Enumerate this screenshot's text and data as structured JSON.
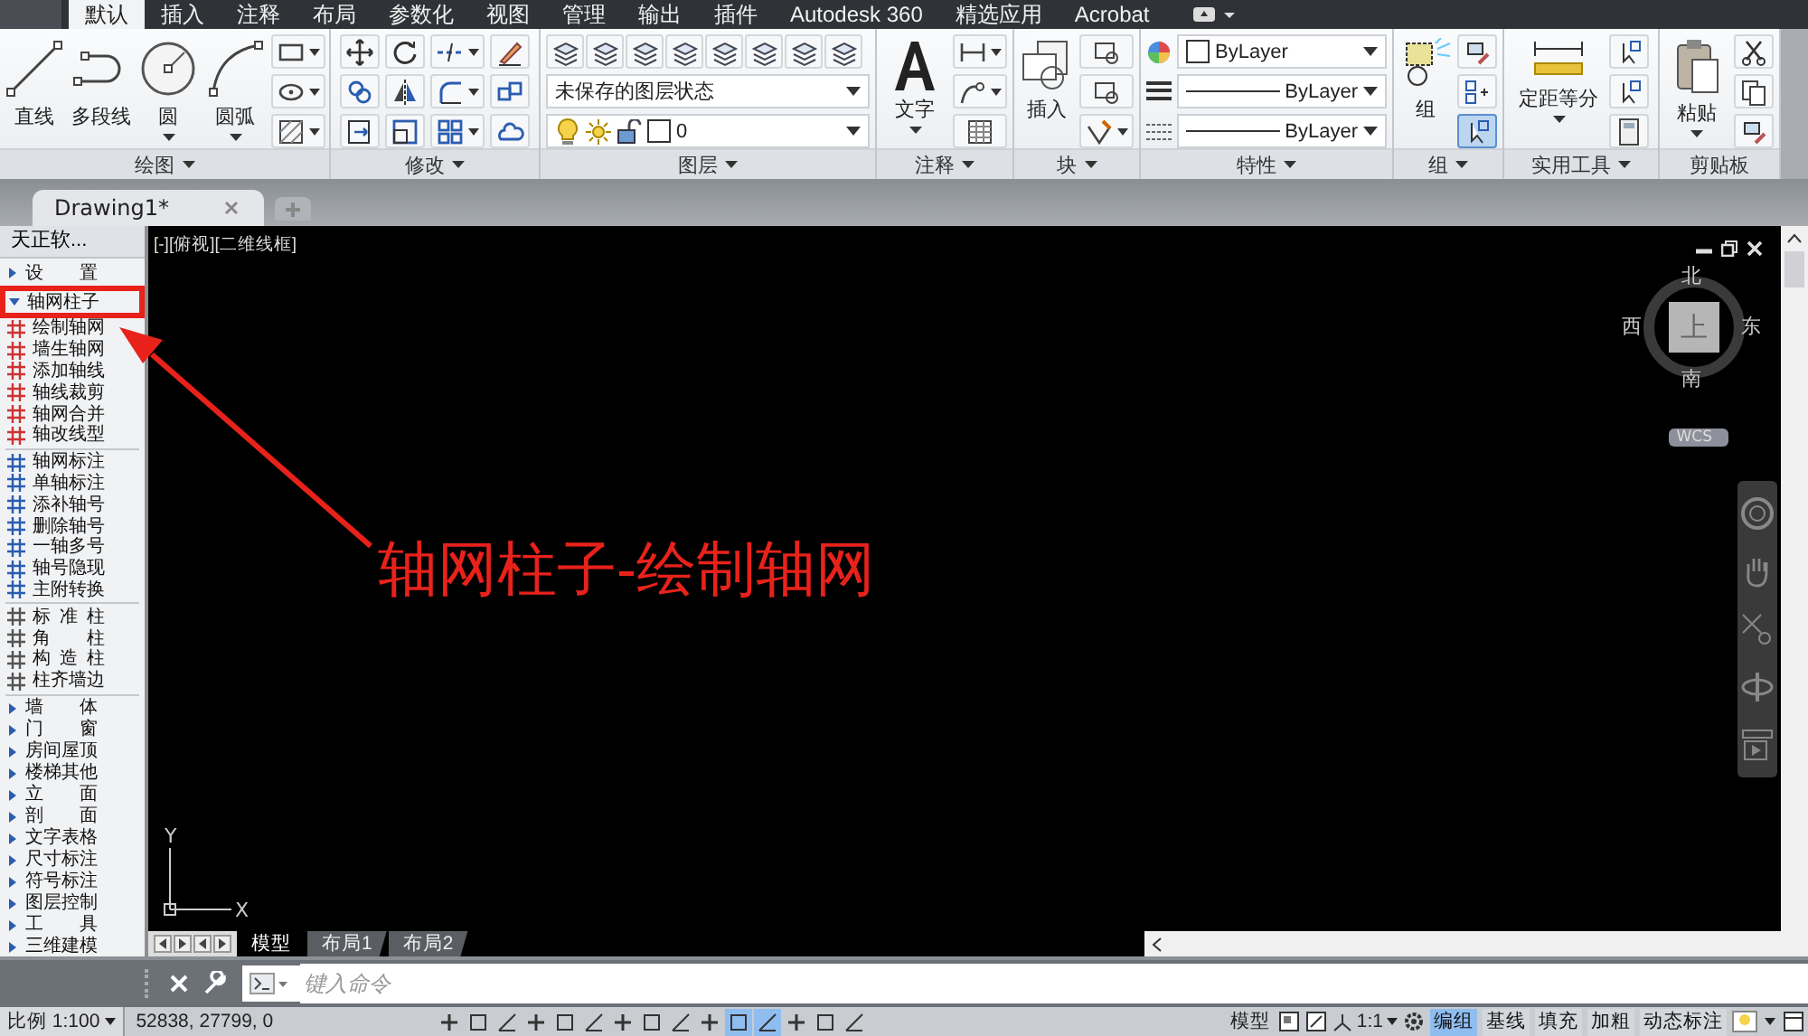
{
  "ribbon_tabs": [
    {
      "label": "默认",
      "selected": true
    },
    {
      "label": "插入",
      "selected": false
    },
    {
      "label": "注释",
      "selected": false
    },
    {
      "label": "布局",
      "selected": false
    },
    {
      "label": "参数化",
      "selected": false
    },
    {
      "label": "视图",
      "selected": false
    },
    {
      "label": "管理",
      "selected": false
    },
    {
      "label": "输出",
      "selected": false
    },
    {
      "label": "插件",
      "selected": false
    },
    {
      "label": "Autodesk 360",
      "selected": false
    },
    {
      "label": "精选应用",
      "selected": false
    },
    {
      "label": "Acrobat",
      "selected": false
    }
  ],
  "panels": {
    "draw": {
      "title": "绘图",
      "tools": [
        "直线",
        "多段线",
        "圆",
        "圆弧"
      ]
    },
    "modify": {
      "title": "修改"
    },
    "layers": {
      "title": "图层",
      "layer_state": "未保存的图层状态",
      "current_layer": "0"
    },
    "annotation": {
      "title": "注释",
      "tool": "文字"
    },
    "block": {
      "title": "块",
      "tool": "插入"
    },
    "properties": {
      "title": "特性",
      "color_value": "ByLayer",
      "lineweight": "ByLayer",
      "linetype": "ByLayer"
    },
    "groups": {
      "title": "组",
      "tool": "组",
      "selection_on": true
    },
    "utilities": {
      "title": "实用工具",
      "tool": "定距等分"
    },
    "clipboard": {
      "title": "剪贴板",
      "tool": "粘贴"
    }
  },
  "document_tabs": [
    {
      "label": "Drawing1*",
      "selected": true
    }
  ],
  "sidebar": {
    "title": "天正软...",
    "sections": [
      {
        "label": "设 置",
        "expanded": false,
        "highlighted": false
      },
      {
        "label": "轴网柱子",
        "expanded": true,
        "highlighted": true,
        "groups": [
          [
            "绘制轴网",
            "墙生轴网",
            "添加轴线",
            "轴线裁剪",
            "轴网合并",
            "轴改线型"
          ],
          [
            "轴网标注",
            "单轴标注",
            "添补轴号",
            "删除轴号",
            "一轴多号",
            "轴号隐现",
            "主附转换"
          ],
          [
            "标 准 柱",
            "角 柱",
            "构 造 柱",
            "柱齐墙边"
          ]
        ]
      },
      {
        "label": "墙 体",
        "expanded": false
      },
      {
        "label": "门 窗",
        "expanded": false
      },
      {
        "label": "房间屋顶",
        "expanded": false
      },
      {
        "label": "楼梯其他",
        "expanded": false
      },
      {
        "label": "立 面",
        "expanded": false
      },
      {
        "label": "剖 面",
        "expanded": false
      },
      {
        "label": "文字表格",
        "expanded": false
      },
      {
        "label": "尺寸标注",
        "expanded": false
      },
      {
        "label": "符号标注",
        "expanded": false
      },
      {
        "label": "图层控制",
        "expanded": false
      },
      {
        "label": "工 具",
        "expanded": false
      },
      {
        "label": "三维建模",
        "expanded": false
      }
    ]
  },
  "viewport": {
    "label": "[-][俯视][二维线框]",
    "viewcube": {
      "north": "北",
      "south": "南",
      "west": "西",
      "east": "东",
      "face": "上",
      "coordinate_system": "WCS"
    },
    "ucs": {
      "y": "Y",
      "x": "X"
    }
  },
  "annotation": {
    "text": "轴网柱子-绘制轴网"
  },
  "layout_tabs": [
    {
      "label": "模型",
      "selected": true
    },
    {
      "label": "布局1",
      "selected": false
    },
    {
      "label": "布局2",
      "selected": false
    }
  ],
  "command_line": {
    "placeholder": "键入命令"
  },
  "status_bar": {
    "scale": "比例 1:100",
    "coordinates": "52838, 27799, 0",
    "drafting_toggles": [
      {
        "on": false
      },
      {
        "on": false
      },
      {
        "on": false
      },
      {
        "on": false
      },
      {
        "on": false
      },
      {
        "on": false
      },
      {
        "on": false
      },
      {
        "on": false
      },
      {
        "on": false
      },
      {
        "on": false
      },
      {
        "on": true
      },
      {
        "on": true
      },
      {
        "on": false
      },
      {
        "on": false
      },
      {
        "on": false
      }
    ],
    "space": "模型",
    "annotation_scale": "1:1",
    "toggles": [
      {
        "label": "编组",
        "on": true
      },
      {
        "label": "基线",
        "on": false
      },
      {
        "label": "填充",
        "on": false
      },
      {
        "label": "加粗",
        "on": false
      },
      {
        "label": "动态标注",
        "on": false
      }
    ]
  }
}
